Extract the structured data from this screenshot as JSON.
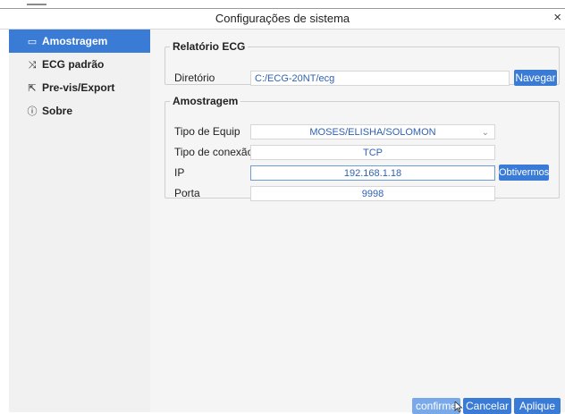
{
  "window": {
    "title": "Configurações de sistema",
    "close_glyph": "×"
  },
  "sidebar": {
    "items": [
      {
        "label": "Amostragem",
        "icon": "image-icon",
        "glyph": "▭",
        "active": true
      },
      {
        "label": "ECG padrão",
        "icon": "shuffle-icon",
        "glyph": "⤨",
        "active": false
      },
      {
        "label": "Pre-vis/Export",
        "icon": "export-icon",
        "glyph": "⇱",
        "active": false
      },
      {
        "label": "Sobre",
        "icon": "info-icon",
        "glyph": "ⓘ",
        "active": false
      }
    ]
  },
  "report_group": {
    "legend": "Relatório ECG",
    "dir_label": "Diretório",
    "dir_value": "C:/ECG-20NT/ecg",
    "browse_button": "Navegar"
  },
  "sampling_group": {
    "legend": "Amostragem",
    "equip_label": "Tipo de Equip",
    "equip_value": "MOSES/ELISHA/SOLOMON",
    "conn_label": "Tipo de conexão",
    "conn_value": "TCP",
    "ip_label": "IP",
    "ip_value": "192.168.1.18",
    "obtain_button": "Obtivermos",
    "port_label": "Porta",
    "port_value": "9998"
  },
  "footer": {
    "confirm": "confirme",
    "cancel": "Cancelar",
    "apply": "Aplique"
  },
  "colors": {
    "accent": "#3a7bd5",
    "value_text": "#2f62b5"
  }
}
